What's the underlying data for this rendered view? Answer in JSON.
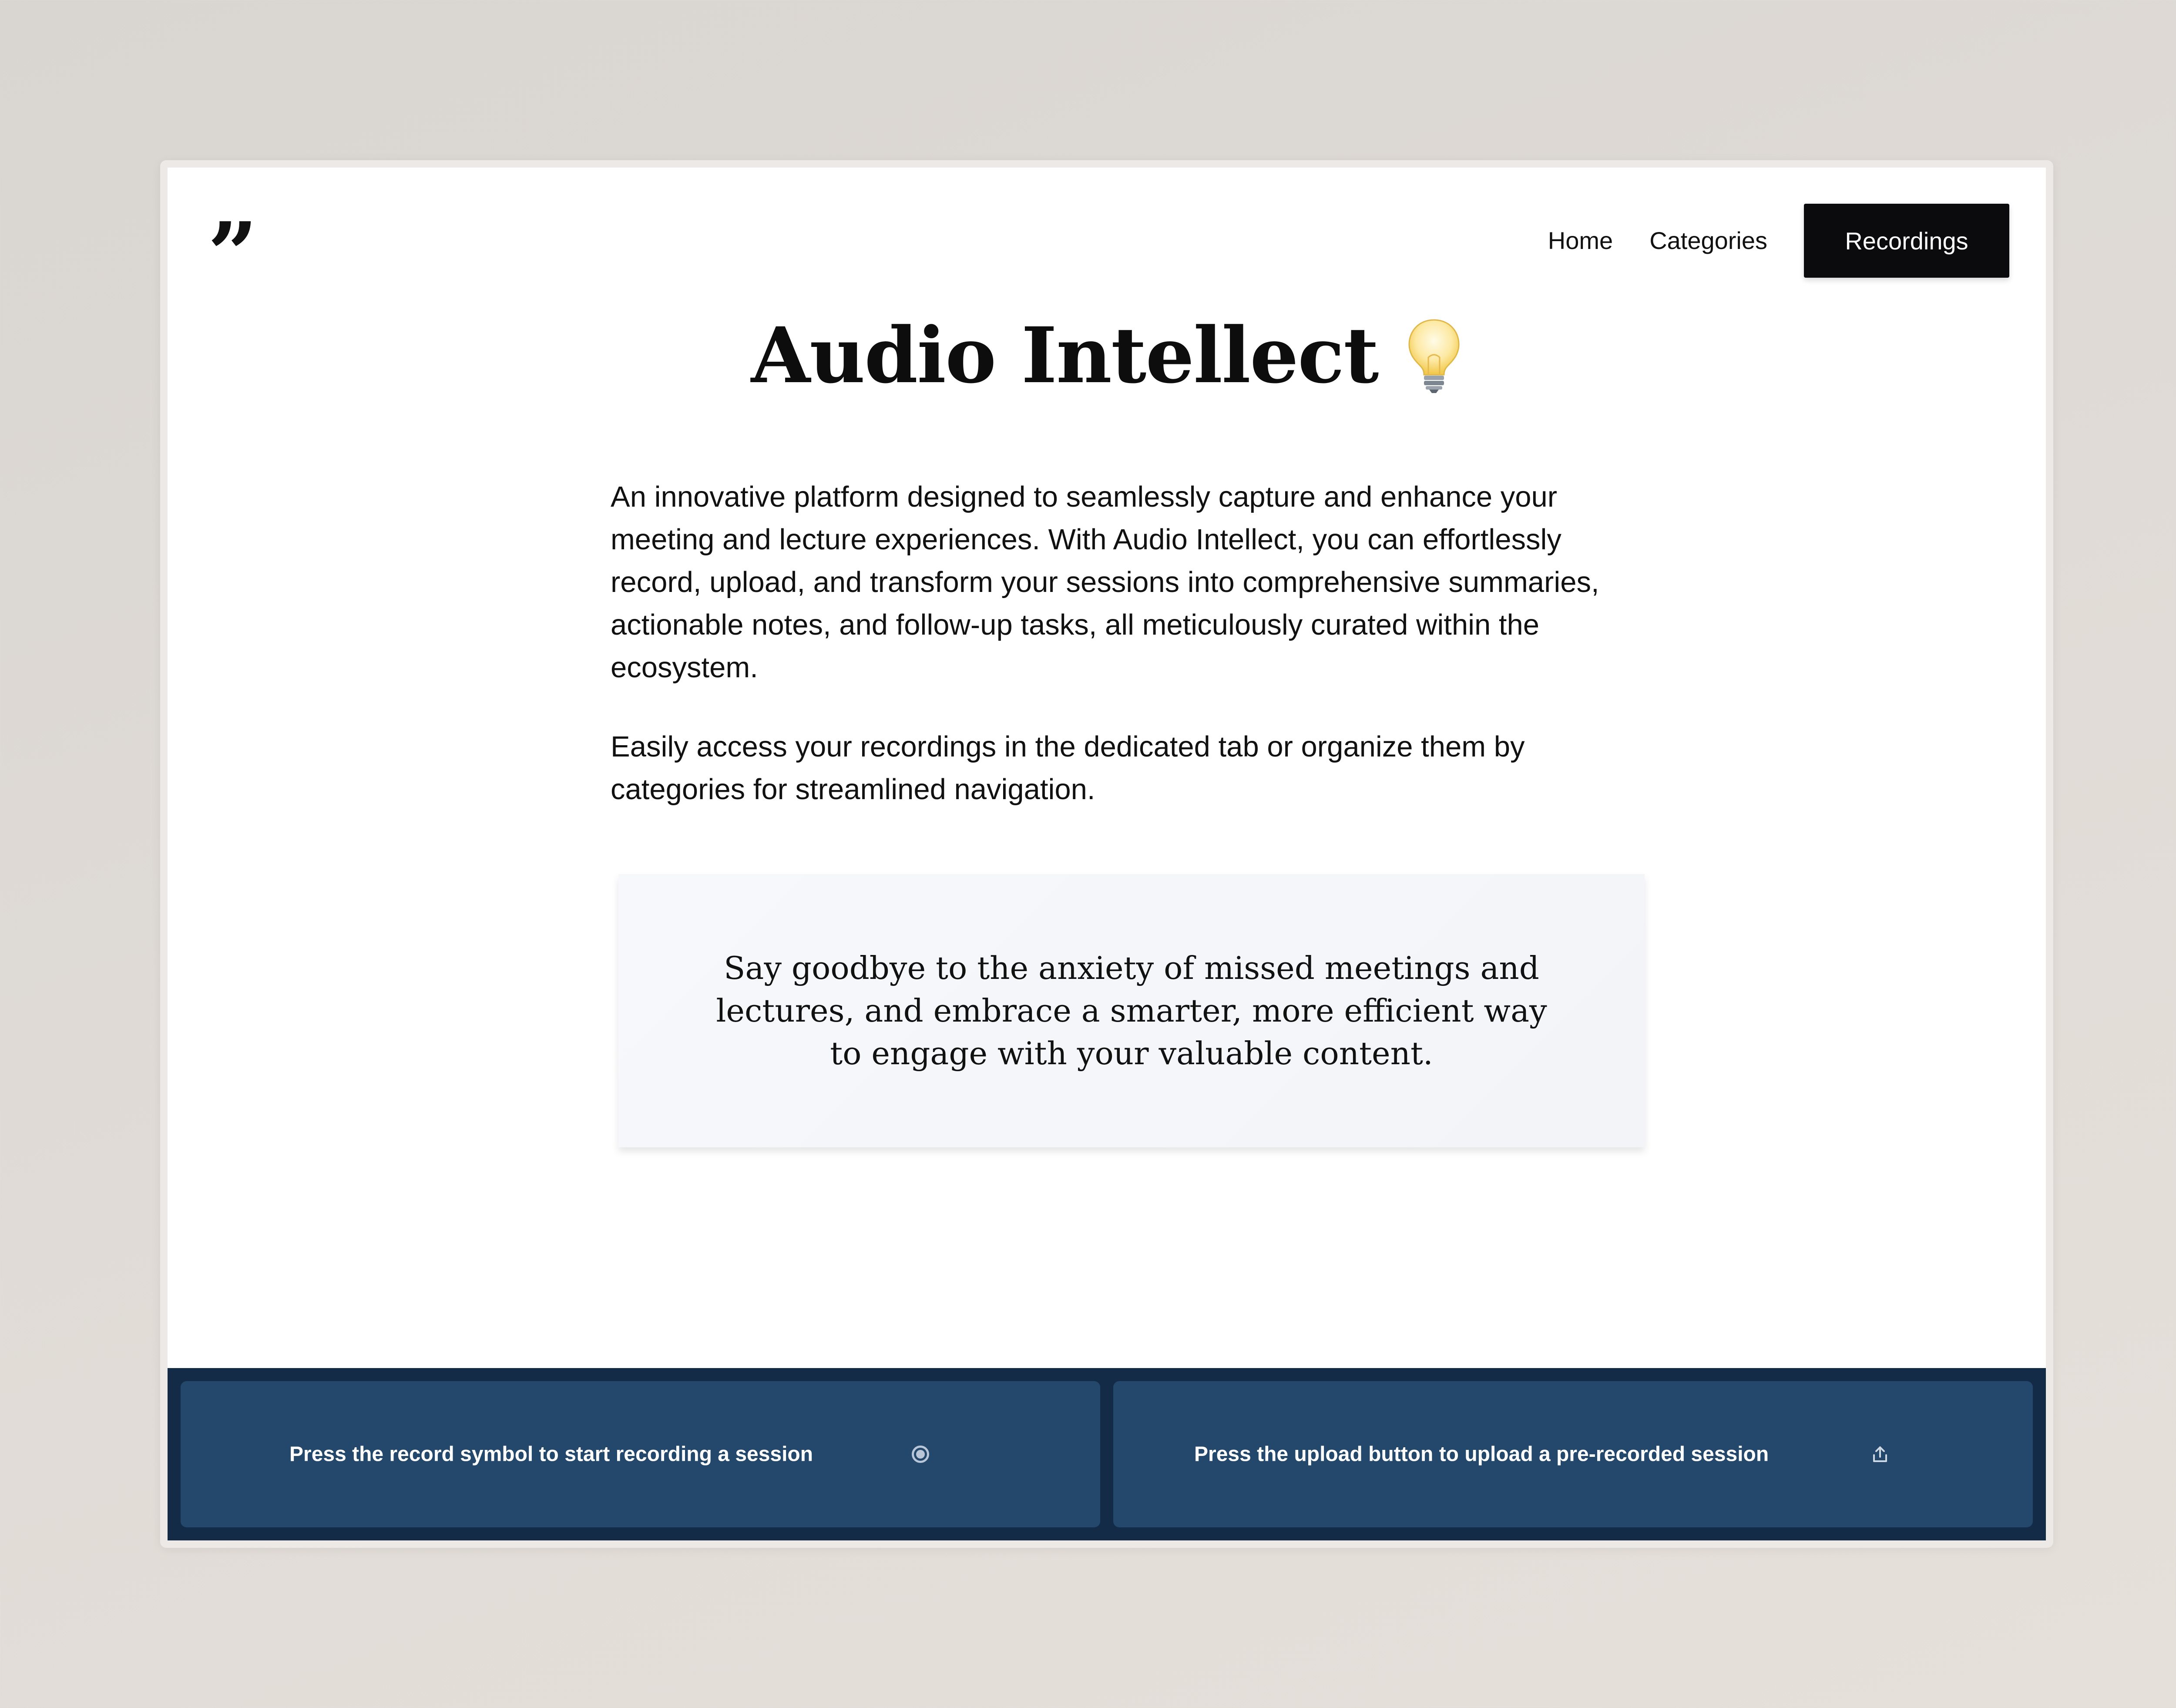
{
  "header": {
    "logo_glyph": "”",
    "nav": {
      "home": "Home",
      "categories": "Categories",
      "recordings": "Recordings"
    }
  },
  "hero": {
    "title": "Audio Intellect",
    "title_icon": "lightbulb-icon"
  },
  "intro": {
    "paragraph1": "An innovative platform designed to seamlessly capture and enhance your meeting and lecture experiences. With Audio Intellect, you can effortlessly record, upload, and transform your sessions into comprehensive summaries, actionable notes, and follow-up tasks, all meticulously curated within the ecosystem.",
    "paragraph2": "Easily access your recordings in the dedicated tab or organize them by categories for streamlined navigation."
  },
  "quote": {
    "text": "Say goodbye to the anxiety of missed meetings and lectures, and embrace a smarter, more efficient way to engage with your valuable content."
  },
  "actions": {
    "record": {
      "label": "Press the record symbol to start recording a session",
      "icon": "record-icon"
    },
    "upload": {
      "label": "Press the upload button to upload a pre-recorded session",
      "icon": "upload-icon"
    }
  },
  "colors": {
    "footer_bg": "#142b48",
    "card_bg": "#23486b",
    "nav_button_bg": "#0b0b0d"
  }
}
